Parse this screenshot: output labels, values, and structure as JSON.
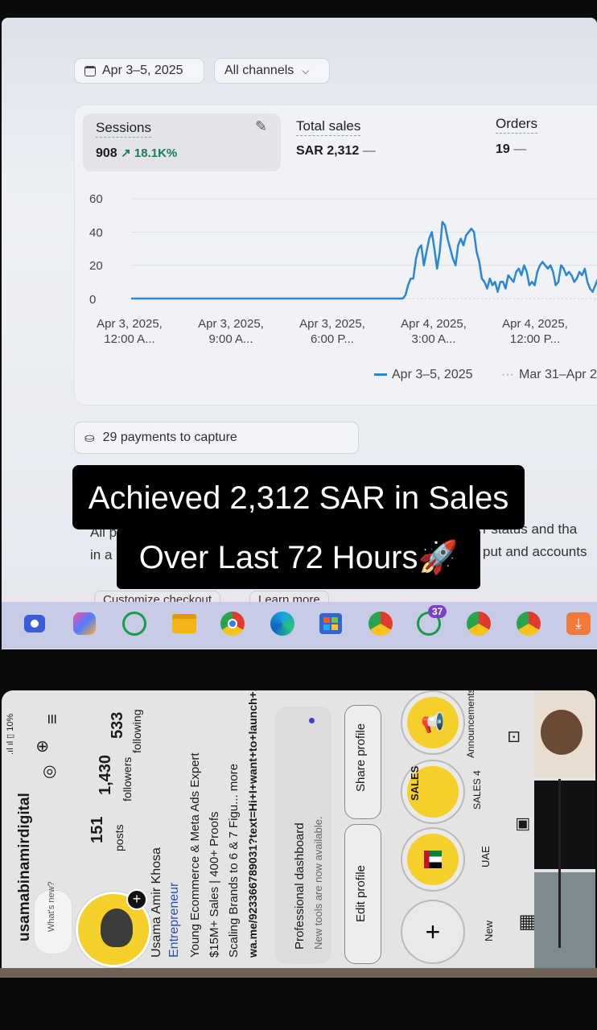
{
  "analytics": {
    "date_range": "Apr 3–5, 2025",
    "channels": "All channels",
    "metrics": [
      {
        "label": "Sessions",
        "value": "908",
        "delta": "↗ 18.1K%"
      },
      {
        "label": "Total sales",
        "value": "SAR 2,312",
        "delta": "—"
      },
      {
        "label": "Orders",
        "value": "19",
        "delta": "—"
      }
    ],
    "payments": "29 payments to capture",
    "partial_left_1": "All p",
    "partial_left_2": "in a",
    "partial_right_1": "r status and tha",
    "partial_right_2": "put and accounts",
    "partial_btn_1": "Customize checkout",
    "partial_btn_2": "Learn more"
  },
  "chart_data": {
    "type": "line",
    "y_ticks": [
      "60",
      "40",
      "20",
      "0"
    ],
    "ylim": [
      0,
      60
    ],
    "x_ticks": [
      [
        "Apr 3, 2025,",
        "12:00 A..."
      ],
      [
        "Apr 3, 2025,",
        "9:00 A..."
      ],
      [
        "Apr 3, 2025,",
        "6:00 P..."
      ],
      [
        "Apr 4, 2025,",
        "3:00 A..."
      ],
      [
        "Apr 4, 2025,",
        "12:00 P..."
      ]
    ],
    "series": [
      {
        "name": "Apr 3–5, 2025",
        "color": "#2a86d6",
        "values": [
          0,
          0,
          0,
          0,
          0,
          0,
          0,
          0,
          0,
          0,
          0,
          0,
          0,
          0,
          0,
          0,
          0,
          0,
          0,
          0,
          0,
          0,
          0,
          0,
          0,
          0,
          0,
          0,
          0,
          0,
          0,
          0,
          0,
          0,
          0,
          0,
          0,
          0,
          0,
          0,
          0,
          0,
          0,
          0,
          0,
          0,
          0,
          0,
          0,
          0,
          0,
          0,
          0,
          0,
          0,
          0,
          0,
          0,
          0,
          0,
          0,
          0,
          0,
          0,
          0,
          0,
          0,
          0,
          0,
          0,
          0,
          0,
          0,
          0,
          0,
          0,
          0,
          0,
          0,
          0,
          0,
          0,
          0,
          0,
          0,
          0,
          0,
          0,
          0,
          0,
          0,
          0,
          0,
          0,
          0,
          0,
          0,
          0,
          0,
          0,
          0,
          0,
          0,
          0,
          2,
          8,
          12,
          12,
          24,
          30,
          32,
          20,
          28,
          36,
          40,
          30,
          18,
          28,
          46,
          44,
          36,
          30,
          24,
          20,
          32,
          36,
          32,
          38,
          40,
          42,
          40,
          28,
          22,
          12,
          10,
          6,
          12,
          8,
          10,
          4,
          10,
          10,
          6,
          14,
          12,
          10,
          16,
          18,
          14,
          20,
          16,
          8,
          10,
          8,
          16,
          20,
          22,
          20,
          18,
          20,
          16,
          8,
          10,
          20,
          18,
          14,
          16,
          14,
          10,
          12,
          16,
          14,
          18,
          10,
          6,
          4,
          8,
          12,
          16,
          24,
          26
        ]
      },
      {
        "name": "Mar 31–Apr 2",
        "color": "#9aa3ad",
        "values": [
          0
        ]
      }
    ]
  },
  "overlay_text": {
    "line1": "Achieved 2,312 SAR in Sales",
    "line2": "Over Last 72 Hours🚀"
  },
  "taskbar": {
    "apps": [
      "meet-icon",
      "copilot-icon",
      "whatsapp-icon",
      "file-explorer-icon",
      "chrome-icon",
      "edge-icon",
      "store-icon",
      "chrome-profile-icon",
      "whatsapp-web-icon",
      "chrome-icon-2",
      "chrome-icon-3",
      "download-icon"
    ],
    "whatsapp_badge": "37"
  },
  "instagram": {
    "status_bar": ".ıl ıl ▯ 10%",
    "username": "usamabinamirdigital",
    "posts_count": "151",
    "posts_label": "posts",
    "followers_count": "1,430",
    "followers_label": "followers",
    "following_count": "533",
    "following_label": "following",
    "note": "What's new?",
    "name": "Usama Amir Khosa",
    "category": "Entrepreneur",
    "bio1": "Young Ecommerce & Meta Ads Expert",
    "bio2": "$15M+ Sales | 400+ Proofs",
    "bio3": "Scaling Brands to 6 & 7 Figu... more",
    "link": "wa.me/923366789031?text=Hi+I+want+to+launch+...",
    "dash_title": "Professional dashboard",
    "dash_sub": "New tools are now available.",
    "edit_profile": "Edit profile",
    "share_profile": "Share profile",
    "highlights": [
      {
        "label": "New"
      },
      {
        "label": "UAE"
      },
      {
        "label": "SALES 4",
        "badge": "SALES"
      },
      {
        "label": "Announcements"
      }
    ]
  }
}
